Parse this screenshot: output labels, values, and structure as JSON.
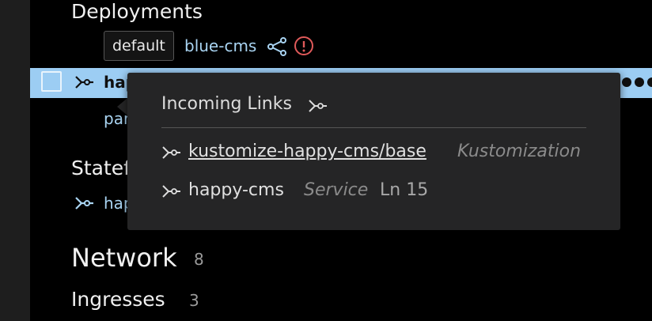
{
  "deployments": {
    "title": "Deployments",
    "badge": "default",
    "name": "blue-cms"
  },
  "selected_row": {
    "name": "hap"
  },
  "row_params": {
    "text": "par"
  },
  "stateful": {
    "title": "Statef",
    "item": "hap"
  },
  "network": {
    "title": "Network",
    "count": "8"
  },
  "ingresses": {
    "title": "Ingresses",
    "count": "3"
  },
  "popup": {
    "title": "Incoming Links",
    "links": [
      {
        "name": "kustomize-happy-cms/base",
        "kind": "Kustomization",
        "location": ""
      },
      {
        "name": "happy-cms",
        "kind": "Service",
        "location": "Ln 15"
      }
    ]
  },
  "colors": {
    "selection": "#9ccdf3",
    "link": "#a9d4f2",
    "error": "#e05a5a",
    "popup_bg": "#252526"
  }
}
